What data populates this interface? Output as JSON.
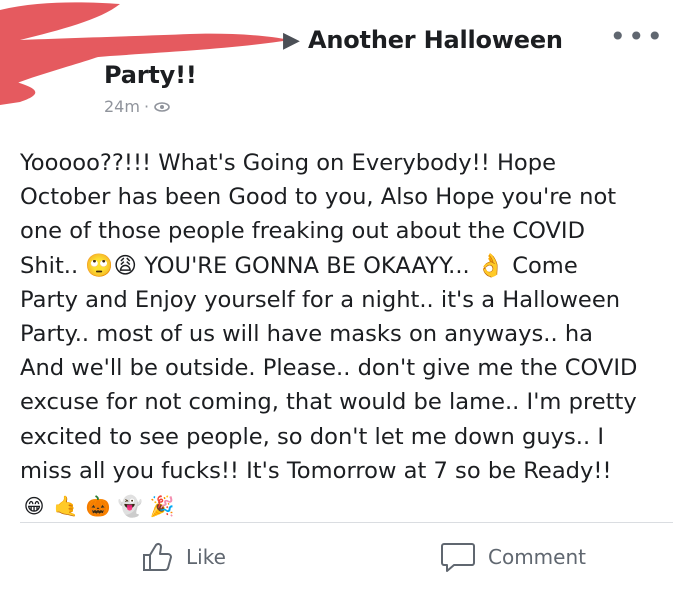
{
  "post": {
    "group_name_line1": "Another Halloween",
    "group_name_line2": "Party!!",
    "time": "24m",
    "separator": "·",
    "audience_icon": "friends-icon",
    "more_icon": "more-options-icon",
    "body_lines": [
      "Yooooo??!!! What's Going on Everybody!! Hope",
      "October has been Good to you, Also Hope you're not",
      "one of those people freaking out about the COVID",
      "Shit.. 🙄😩 YOU'RE GONNA BE OKAAYY... 👌 Come",
      "Party and Enjoy yourself for a night.. it's a Halloween",
      "Party.. most of us will have masks on anyways.. ha",
      "And we'll be outside. Please.. don't give me the COVID",
      "excuse for not coming, that would be lame.. I'm pretty",
      "excited to see people, so don't let me down guys.. I",
      "miss all you fucks!! It's Tomorrow at 7 so be Ready!!"
    ],
    "emojis": [
      "😁",
      "🤙",
      "🎃",
      "👻",
      "🎉"
    ]
  },
  "actions": {
    "like_label": "Like",
    "comment_label": "Comment"
  },
  "colors": {
    "redaction": "#e55a5f",
    "text": "#1c1e21",
    "meta": "#90949c",
    "action": "#606770"
  }
}
